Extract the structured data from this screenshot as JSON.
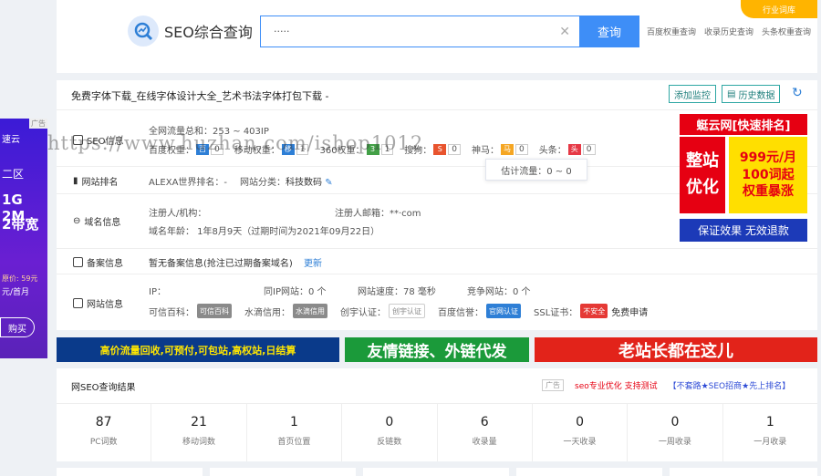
{
  "header": {
    "logo_text": "SEO综合查询",
    "search_value": "·····",
    "search_button": "查询",
    "links": [
      "百度权重查询",
      "收录历史查询",
      "头条权重查询"
    ],
    "corner_badge": "行业词库"
  },
  "left_ad": {
    "tag": "广告",
    "lines": [
      "速云",
      "二区",
      "1G 2M",
      "2带宽",
      "原价: 59元",
      "元/首月",
      "购买"
    ]
  },
  "site": {
    "title": "免费字体下载_在线字体设计大全_艺术书法字体打包下载 - ",
    "btn_monitor": "添加监控",
    "btn_history": "历史数据"
  },
  "rows": {
    "seo": {
      "label": "SEO信息",
      "traffic": "全网流量总和：253 ~ 403IP",
      "weights": [
        {
          "name": "百度权重：",
          "value": "0",
          "color": "#2e7fd6"
        },
        {
          "name": "移动权重：",
          "value": "1",
          "color": "#2e7fd6"
        },
        {
          "name": "360权重：",
          "value": "1",
          "color": "#43a047"
        },
        {
          "name": "搜狗：",
          "value": "0",
          "color": "#e8542e"
        },
        {
          "name": "神马：",
          "value": "0",
          "color": "#f5a623"
        },
        {
          "name": "头条：",
          "value": "0",
          "color": "#e63946"
        }
      ],
      "popup": "估计流量：0 ~ 0"
    },
    "rank": {
      "label": "网站排名",
      "alexa": "ALEXA世界排名：-",
      "category_label": "网站分类：",
      "category_value": "科技数码"
    },
    "domain": {
      "label": "域名信息",
      "registrant": "注册人/机构：",
      "email_label": "注册人邮箱：",
      "email_value": "**·com",
      "age": "域名年龄： 1年8月9天（过期时间为2021年09月22日）"
    },
    "icp": {
      "label": "备案信息",
      "text": "暂无备案信息(抢注已过期备案域名)",
      "update": "更新"
    },
    "site_info": {
      "label": "网站信息",
      "ip": "IP：",
      "same_ip": "同IP网站：0 个",
      "speed": "网站速度：78 毫秒",
      "compete": "竞争网站：0 个",
      "credit_items": [
        {
          "label": "可信百科：",
          "badge": "可信百科",
          "color": "#8a8a8a"
        },
        {
          "label": "水滴信用：",
          "badge": "水滴信用",
          "color": "#8a8a8a"
        },
        {
          "label": "创宇认证：",
          "badge": "创宇认证",
          "color": "#8a8a8a"
        },
        {
          "label": "百度信誉：",
          "badge": "官网认证",
          "color": "#2e7fd6"
        }
      ],
      "ssl_label": "SSL证书：",
      "ssl_badge": "不安全",
      "ssl_free": "免费申请"
    }
  },
  "right_ad": {
    "top": "蜓云网[快速排名]",
    "left_lines": [
      "整站",
      "优化"
    ],
    "right_lines": [
      "999元/月",
      "100词起",
      "权重暴涨"
    ],
    "bottom": "保证效果 无效退款",
    "tag": "广告"
  },
  "banners": {
    "b1": "高价流量回收,可预付,可包站,高权站,日结算",
    "b2": "友情链接、外链代发",
    "b3": "老站长都在这儿"
  },
  "results": {
    "title": "网SEO查询结果",
    "ad_tag": "广告",
    "link1": "seo专业优化 支持测试",
    "link2": "【不套路★SEO招商★先上排名】",
    "stats": [
      {
        "num": "87",
        "label": "PC词数"
      },
      {
        "num": "21",
        "label": "移动词数"
      },
      {
        "num": "1",
        "label": "首页位置"
      },
      {
        "num": "0",
        "label": "反链数"
      },
      {
        "num": "6",
        "label": "收录量"
      },
      {
        "num": "0",
        "label": "一天收录"
      },
      {
        "num": "0",
        "label": "一周收录"
      },
      {
        "num": "1",
        "label": "一月收录"
      }
    ]
  },
  "watermark": "https://www.huzhan.com/ishop1012"
}
